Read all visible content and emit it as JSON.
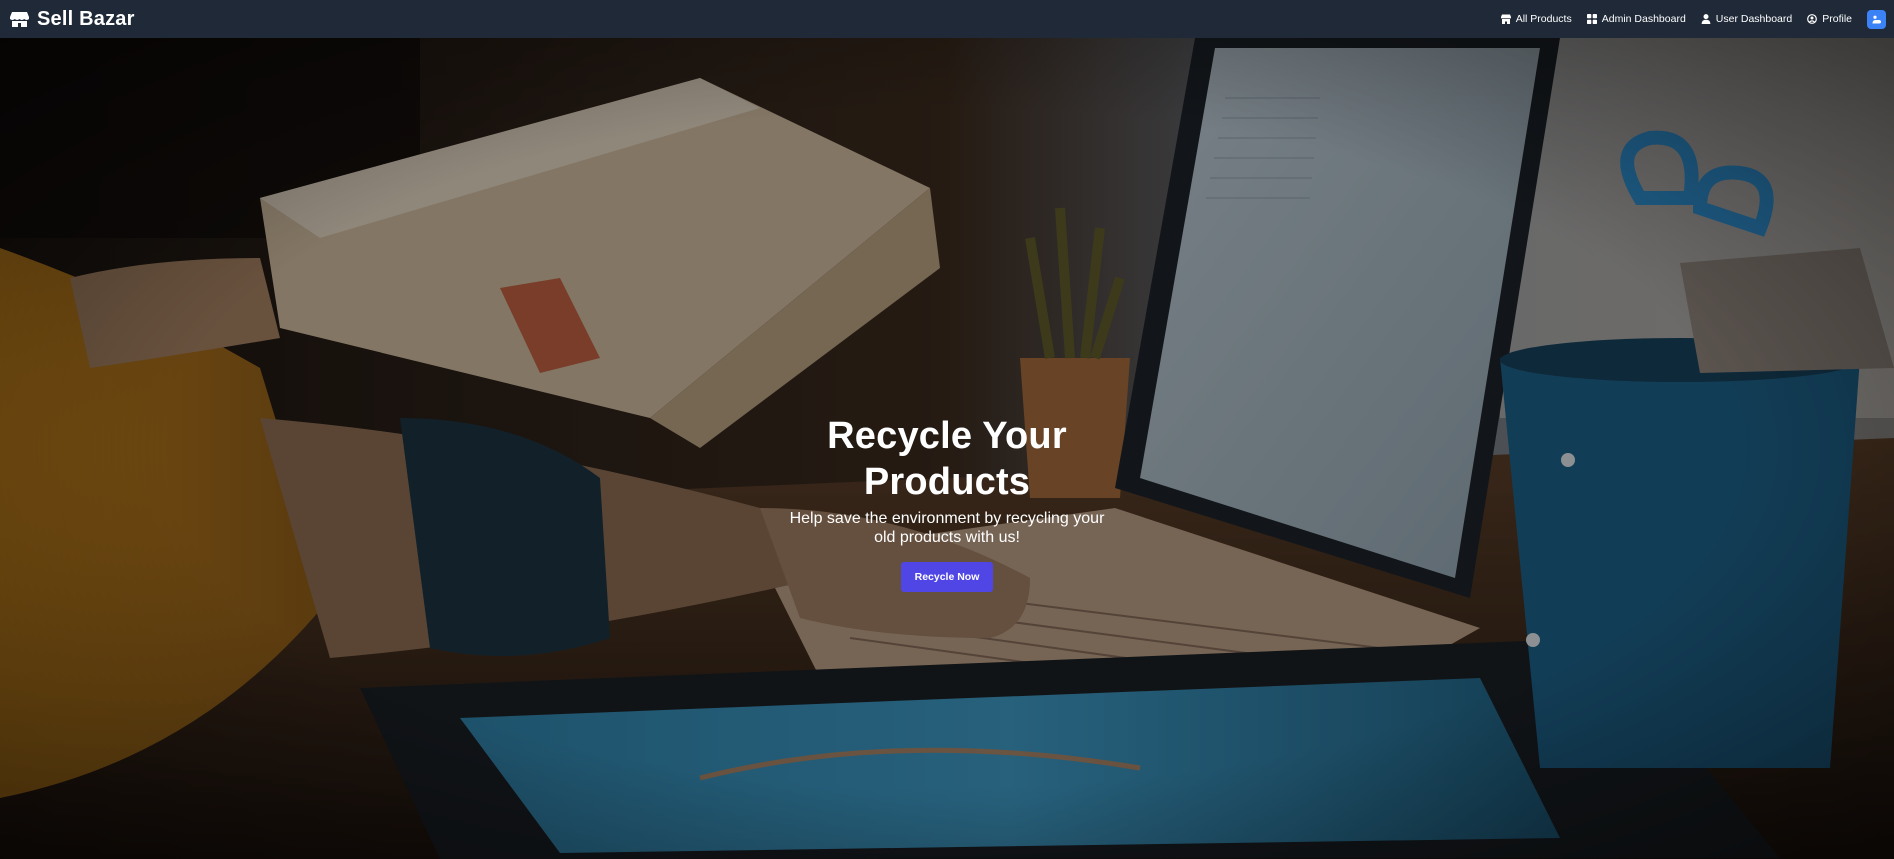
{
  "brand": {
    "name": "Sell Bazar",
    "icon": "store-icon"
  },
  "nav": {
    "links": [
      {
        "label": "All Products",
        "icon": "store-icon"
      },
      {
        "label": "Admin Dashboard",
        "icon": "grid-icon"
      },
      {
        "label": "User Dashboard",
        "icon": "user-icon"
      },
      {
        "label": "Profile",
        "icon": "user-circle-icon"
      }
    ],
    "theme_toggle_icon": "toggle-icon"
  },
  "hero": {
    "title": "Recycle Your Products",
    "subtitle": "Help save the environment by recycling your old products with us!",
    "button_label": "Recycle Now"
  },
  "colors": {
    "navbar": "#1f2937",
    "accent_button": "#4f46e5",
    "toggle": "#3b82f6"
  }
}
